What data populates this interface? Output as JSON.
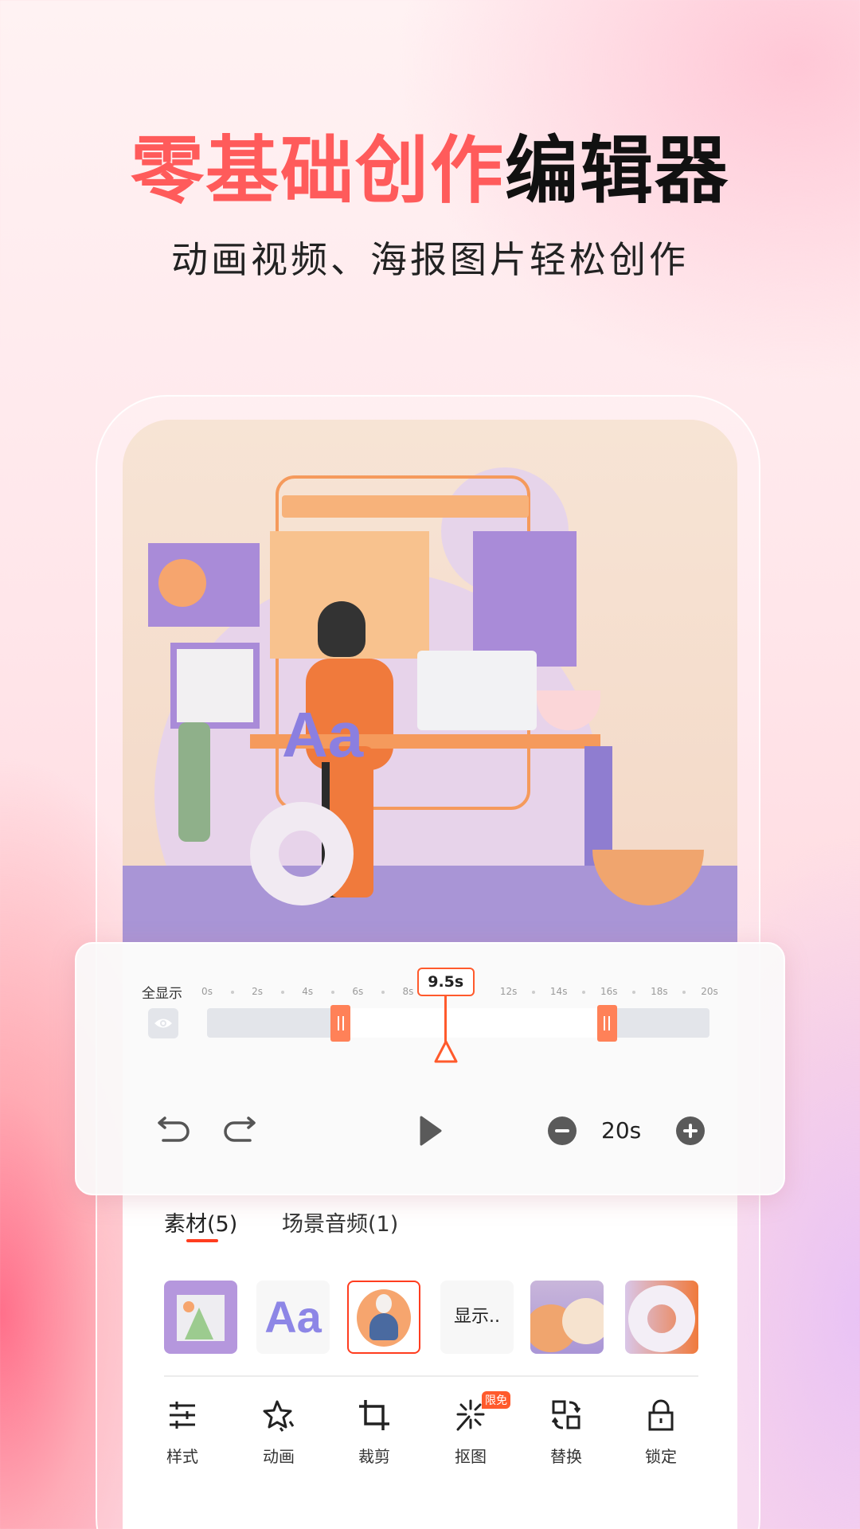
{
  "header": {
    "title_highlight": "零基础创作",
    "title_rest": "编辑器",
    "subtitle": "动画视频、海报图片轻松创作"
  },
  "timeline": {
    "show_all_label": "全显示",
    "ticks": [
      "0s",
      "2s",
      "4s",
      "6s",
      "8s",
      "12s",
      "14s",
      "16s",
      "18s",
      "20s"
    ],
    "playhead_label": "9.5s",
    "playhead_seconds": 9.5,
    "selection_start_seconds": 5.3,
    "selection_end_seconds": 15.9,
    "total_seconds": 20,
    "duration_label": "20s",
    "accent_color": "#ff5a2c",
    "handle_color": "#ff8158"
  },
  "tabs": [
    {
      "label": "素材(5)",
      "active": true
    },
    {
      "label": "场景音频(1)",
      "active": false
    }
  ],
  "thumbnails": [
    {
      "kind": "image-placeholder"
    },
    {
      "kind": "text",
      "text": "Aa"
    },
    {
      "kind": "avatar",
      "selected": true
    },
    {
      "kind": "text",
      "text": "显示.."
    },
    {
      "kind": "hemispheres"
    },
    {
      "kind": "torus"
    }
  ],
  "toolbar": [
    {
      "label": "样式",
      "icon": "sliders-icon"
    },
    {
      "label": "动画",
      "icon": "star-sparkle-icon"
    },
    {
      "label": "裁剪",
      "icon": "crop-icon"
    },
    {
      "label": "抠图",
      "icon": "magic-wand-icon",
      "badge": "限免"
    },
    {
      "label": "替换",
      "icon": "swap-icon"
    },
    {
      "label": "锁定",
      "icon": "lock-icon"
    }
  ]
}
